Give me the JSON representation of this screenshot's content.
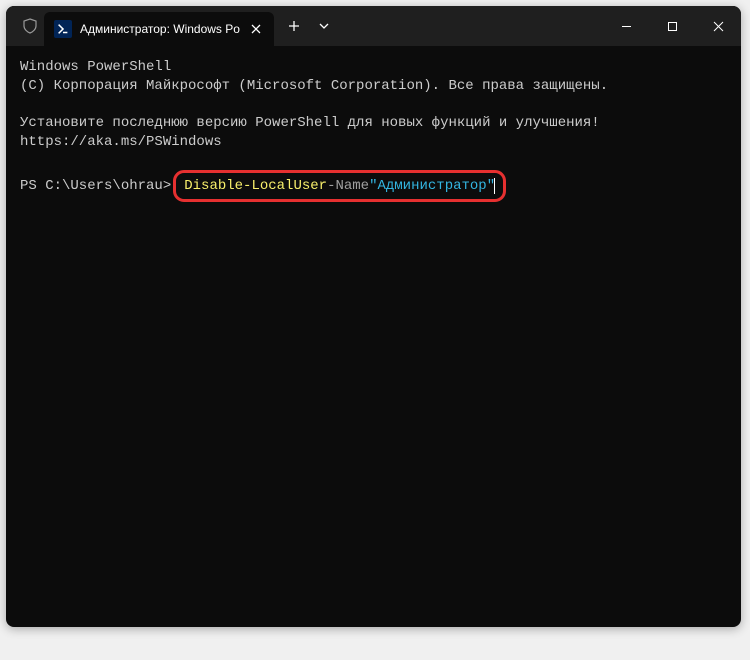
{
  "tab": {
    "title": "Администратор: Windows Po"
  },
  "terminal": {
    "line1": "Windows PowerShell",
    "line2": "(C) Корпорация Майкрософт (Microsoft Corporation). Все права защищены.",
    "line3": "Установите последнюю версию PowerShell для новых функций и улучшения! https://aka.ms/PSWindows",
    "prompt": "PS C:\\Users\\ohrau>",
    "cmdlet": "Disable-LocalUser",
    "param": " -Name ",
    "string": "\"Администратор\""
  }
}
